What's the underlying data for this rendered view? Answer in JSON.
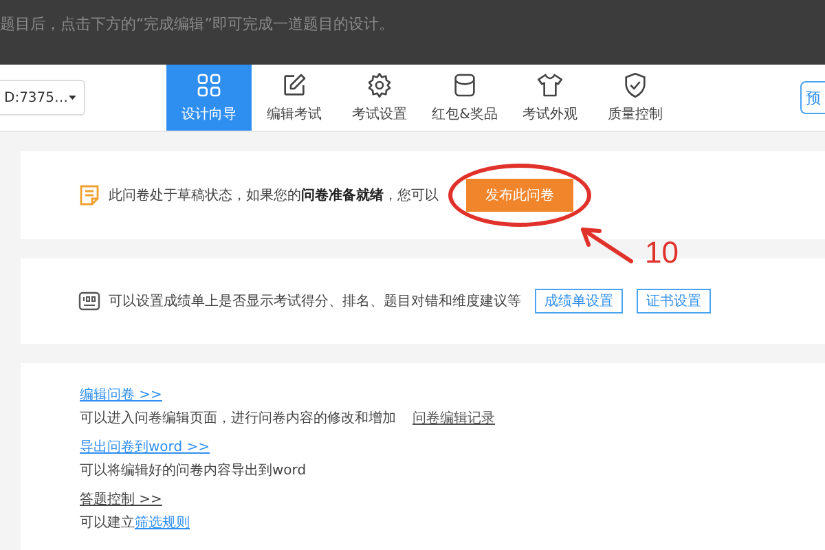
{
  "overlay": {
    "hint": "题目后，点击下方的“完成编辑”即可完成一道题目的设计。"
  },
  "nav": {
    "survey_select": "D:7375…",
    "tabs": [
      {
        "label": "设计向导",
        "selected": true
      },
      {
        "label": "编辑考试",
        "selected": false
      },
      {
        "label": "考试设置",
        "selected": false
      },
      {
        "label": "红包&奖品",
        "selected": false
      },
      {
        "label": "考试外观",
        "selected": false
      },
      {
        "label": "质量控制",
        "selected": false
      }
    ],
    "right_button": "预"
  },
  "draft_card": {
    "message": "此问卷处于草稿状态，如果您的**问卷准备就绪**，您可以",
    "button": "发布此问卷",
    "annotation": "10"
  },
  "report_card": {
    "message": "可以设置成绩单上是否显示考试得分、排名、题目对错和维度建议等",
    "buttons": [
      "成绩单设置",
      "证书设置"
    ]
  },
  "actions": [
    {
      "link": "编辑问卷 >>",
      "kind": "primary",
      "description": "可以进入问卷编辑页面，进行问卷内容的修改和增加",
      "extra_link": "问卷编辑记录"
    },
    {
      "link": "导出问卷到word >>",
      "kind": "primary",
      "description": "可以将编辑好的问卷内容导出到word"
    },
    {
      "link": "答题控制 >>",
      "kind": "plain",
      "description": "可以建立",
      "inline_link": "筛选规则"
    }
  ]
}
